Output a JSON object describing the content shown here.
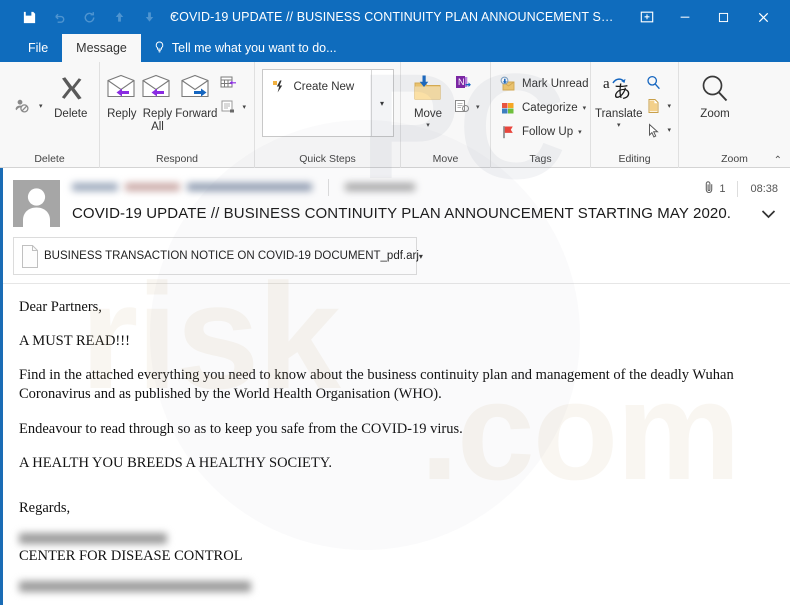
{
  "window": {
    "title": "COVID-19 UPDATE // BUSINESS CONTINUITY PLAN ANNOUNCEMENT STA...",
    "accent_color": "#0f6cbd"
  },
  "quick_access": {
    "save": "save-icon",
    "undo": "undo-icon",
    "redo": "redo-icon",
    "previous": "up-arrow-icon",
    "next": "down-arrow-icon",
    "customize": "chevron-down-icon"
  },
  "window_controls": {
    "ribbon_display": "ribbon-display-options",
    "minimize": "minimize",
    "maximize": "maximize",
    "close": "close"
  },
  "tabs": {
    "file": "File",
    "message": "Message",
    "tell_me_placeholder": "Tell me what you want to do..."
  },
  "ribbon": {
    "groups": [
      {
        "label": "Delete",
        "items": [
          {
            "label": "Ignore",
            "icon": "ignore-icon"
          },
          {
            "label": "Delete",
            "icon": "delete-x-icon"
          }
        ]
      },
      {
        "label": "Respond",
        "items": [
          {
            "label": "Reply",
            "icon": "reply-envelope-icon"
          },
          {
            "label": "Reply All",
            "icon": "reply-all-envelope-icon"
          },
          {
            "label": "Forward",
            "icon": "forward-envelope-icon"
          },
          {
            "label": "Meeting",
            "icon": "meeting-icon"
          },
          {
            "label": "More",
            "icon": "more-respond-icon"
          }
        ]
      },
      {
        "label": "Quick Steps",
        "create_new": "Create New",
        "create_new_icon": "lightning-bolt-icon",
        "dropdown": "chevron-down-icon",
        "launcher": "dialog-launcher-icon"
      },
      {
        "label": "Move",
        "items": [
          {
            "label": "Move",
            "icon": "move-folder-icon"
          },
          {
            "label": "OneNote",
            "icon": "onenote-icon"
          },
          {
            "label": "Rules",
            "icon": "rules-icon"
          }
        ]
      },
      {
        "label": "Tags",
        "items": [
          {
            "label": "Mark Unread",
            "icon": "mark-unread-icon"
          },
          {
            "label": "Categorize",
            "icon": "categorize-icon"
          },
          {
            "label": "Follow Up",
            "icon": "follow-up-flag-icon"
          }
        ],
        "launcher": "dialog-launcher-icon"
      },
      {
        "label": "Editing",
        "items": [
          {
            "label": "Translate",
            "icon": "translate-icon"
          },
          {
            "label": "Find",
            "icon": "search-icon"
          },
          {
            "label": "Related",
            "icon": "related-document-icon"
          },
          {
            "label": "Select",
            "icon": "select-cursor-icon"
          }
        ]
      },
      {
        "label": "Zoom",
        "items": [
          {
            "label": "Zoom",
            "icon": "zoom-magnifier-icon"
          }
        ]
      }
    ],
    "collapse": "collapse-ribbon-icon"
  },
  "message": {
    "avatar": "contact-avatar-icon",
    "sender_redacted": true,
    "subject": "COVID-19 UPDATE // BUSINESS CONTINUITY PLAN ANNOUNCEMENT STARTING MAY 2020.",
    "attachment_count": "1",
    "attachment_icon": "paperclip-icon",
    "time": "08:38",
    "expand_header": "chevron-down-icon",
    "attachment": {
      "name": "BUSINESS TRANSACTION NOTICE ON COVID-19 DOCUMENT_pdf.arj",
      "icon": "file-document-icon",
      "caret": "chevron-down-icon"
    },
    "body": {
      "greeting": "Dear Partners,",
      "p1": "A MUST READ!!!",
      "p2": "Find in the attached everything you need to know about the business continuity plan and management of the deadly Wuhan Coronavirus and as published by the World Health Organisation (WHO).",
      "p3": "Endeavour to read through so as to keep you safe from the COVID-19 virus.",
      "p4": "A HEALTH YOU BREEDS A HEALTHY SOCIETY.",
      "signoff": "Regards,",
      "organisation": "CENTER FOR DISEASE CONTROL"
    }
  }
}
